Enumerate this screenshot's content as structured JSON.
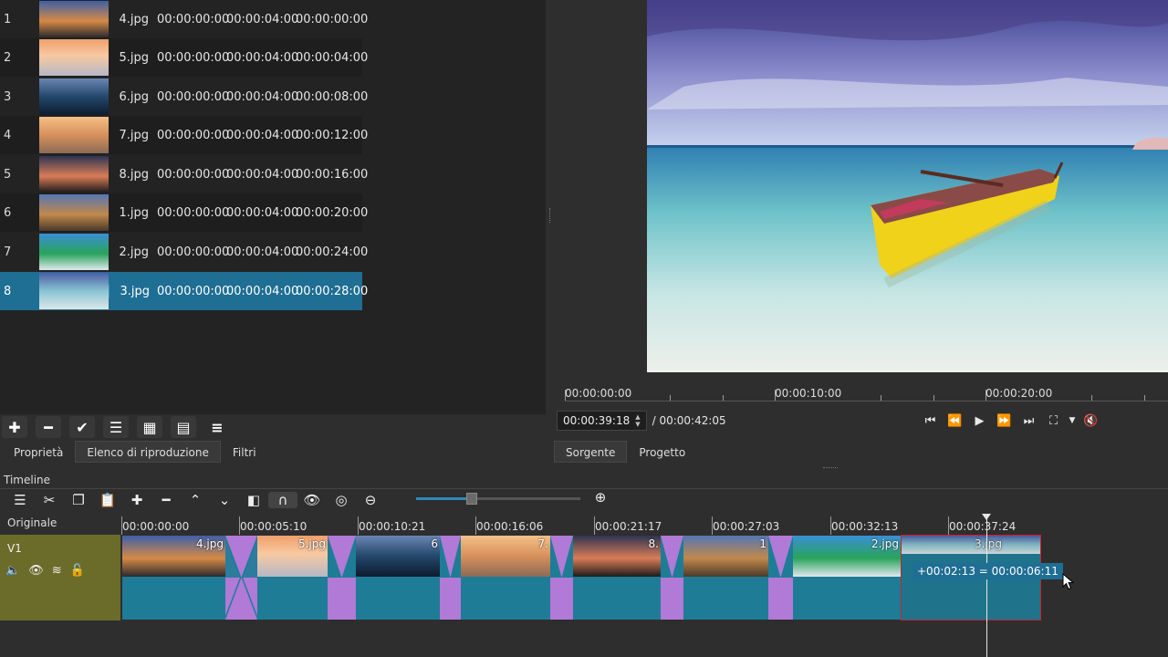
{
  "playlist": {
    "rows": [
      {
        "num": "1",
        "name": "4.jpg",
        "in": "00:00:00:00",
        "duration": "00:00:04:00",
        "start": "00:00:00:00"
      },
      {
        "num": "2",
        "name": "5.jpg",
        "in": "00:00:00:00",
        "duration": "00:00:04:00",
        "start": "00:00:04:00"
      },
      {
        "num": "3",
        "name": "6.jpg",
        "in": "00:00:00:00",
        "duration": "00:00:04:00",
        "start": "00:00:08:00"
      },
      {
        "num": "4",
        "name": "7.jpg",
        "in": "00:00:00:00",
        "duration": "00:00:04:00",
        "start": "00:00:12:00"
      },
      {
        "num": "5",
        "name": "8.jpg",
        "in": "00:00:00:00",
        "duration": "00:00:04:00",
        "start": "00:00:16:00"
      },
      {
        "num": "6",
        "name": "1.jpg",
        "in": "00:00:00:00",
        "duration": "00:00:04:00",
        "start": "00:00:20:00"
      },
      {
        "num": "7",
        "name": "2.jpg",
        "in": "00:00:00:00",
        "duration": "00:00:04:00",
        "start": "00:00:24:00"
      },
      {
        "num": "8",
        "name": "3.jpg",
        "in": "00:00:00:00",
        "duration": "00:00:04:00",
        "start": "00:00:28:00"
      }
    ],
    "toolbar_icons": [
      "add-icon",
      "remove-icon",
      "check-icon",
      "list-view-icon",
      "grid-view-icon",
      "details-view-icon",
      "menu-icon"
    ],
    "toolbar_glyphs": [
      "✚",
      "━",
      "✔",
      "☰",
      "▦",
      "▤",
      "≡"
    ]
  },
  "left_tabs": [
    {
      "label": "Proprietà",
      "active": false
    },
    {
      "label": "Elenco di riproduzione",
      "active": true
    },
    {
      "label": "Filtri",
      "active": false
    }
  ],
  "viewer": {
    "ruler_labels": [
      "00:00:00:00",
      "00:00:10:00",
      "00:00:20:00"
    ],
    "position": "00:00:39:18",
    "duration": "/ 00:00:42:05"
  },
  "right_tabs": [
    {
      "label": "Sorgente",
      "active": true
    },
    {
      "label": "Progetto",
      "active": false
    }
  ],
  "timeline": {
    "title": "Timeline",
    "header_label": "Originale",
    "track_name": "V1",
    "ruler_labels": [
      "00:00:00:00",
      "00:00:05:10",
      "00:00:10:21",
      "00:00:16:06",
      "00:00:21:17",
      "00:00:27:03",
      "00:00:32:13",
      "00:00:37:24"
    ],
    "clips": [
      {
        "label": "4.jpg"
      },
      {
        "label": "5.jpg"
      },
      {
        "label": "6"
      },
      {
        "label": "7."
      },
      {
        "label": "8."
      },
      {
        "label": "1"
      },
      {
        "label": "2.jpg"
      },
      {
        "label": "3.jpg"
      }
    ],
    "drag_tooltip": "+00:02:13 = 00:00:06:11"
  },
  "colors": {
    "selection": "#1f6e93",
    "clip": "#1e7c97",
    "transition": "#b07ad6",
    "track_header": "#6c6c2a",
    "selected_clip_border": "#c8232e"
  }
}
